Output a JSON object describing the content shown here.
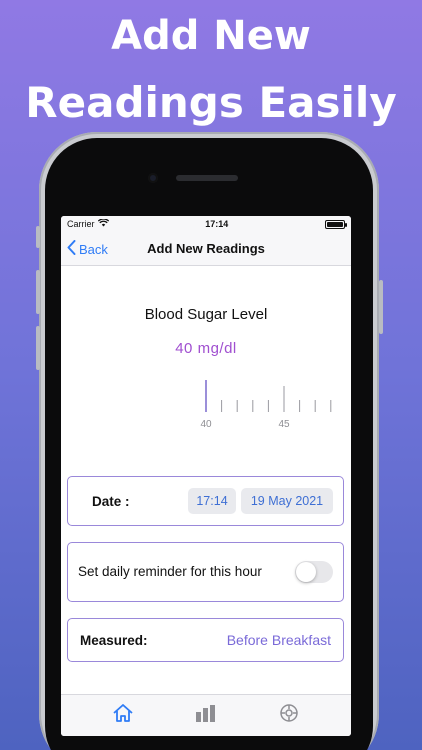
{
  "promo": {
    "line1": "Add New",
    "line2": "Readings Easily"
  },
  "statusbar": {
    "carrier": "Carrier",
    "time": "17:14"
  },
  "navbar": {
    "back_label": "Back",
    "title": "Add New Readings"
  },
  "reading": {
    "title": "Blood Sugar Level",
    "value": "40",
    "unit": "mg/dl",
    "ruler_labels": [
      "40",
      "45"
    ],
    "selected_value": 40
  },
  "date_row": {
    "label": "Date :",
    "time": "17:14",
    "date": "19 May 2021"
  },
  "reminder_row": {
    "label": "Set daily reminder for this hour",
    "enabled": false
  },
  "measured_row": {
    "label": "Measured:",
    "value": "Before Breakfast"
  },
  "tabbar": {
    "items": [
      {
        "icon": "home-icon",
        "active": true
      },
      {
        "icon": "chart-icon",
        "active": false
      },
      {
        "icon": "gear-icon",
        "active": false
      }
    ]
  },
  "colors": {
    "accent_blue": "#2f7cf6",
    "value_purple": "#a04fd0",
    "card_border": "#9a88da",
    "tab_inactive": "#8e8e93"
  }
}
